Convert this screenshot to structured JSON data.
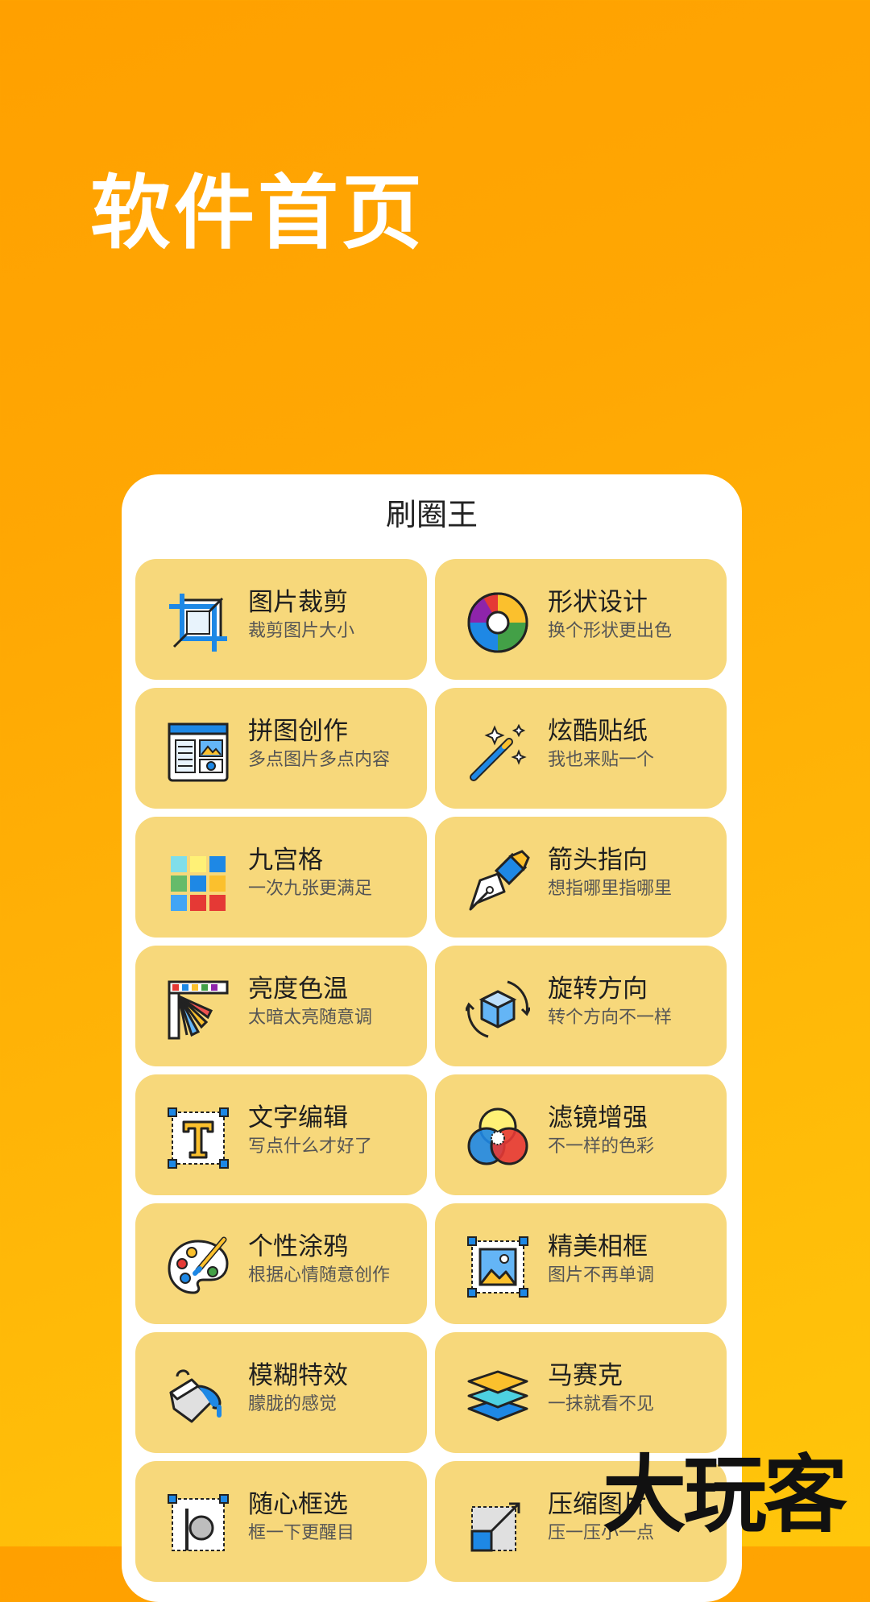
{
  "header": {
    "title": "软件首页"
  },
  "card": {
    "title": "刷圈王",
    "items": [
      {
        "name": "图片裁剪",
        "desc": "裁剪图片大小",
        "icon": "crop-icon"
      },
      {
        "name": "形状设计",
        "desc": "换个形状更出色",
        "icon": "color-wheel-icon"
      },
      {
        "name": "拼图创作",
        "desc": "多点图片多点内容",
        "icon": "collage-icon"
      },
      {
        "name": "炫酷贴纸",
        "desc": "我也来贴一个",
        "icon": "magic-wand-icon"
      },
      {
        "name": "九宫格",
        "desc": "一次九张更满足",
        "icon": "nine-grid-icon"
      },
      {
        "name": "箭头指向",
        "desc": "想指哪里指哪里",
        "icon": "pen-nib-icon"
      },
      {
        "name": "亮度色温",
        "desc": "太暗太亮随意调",
        "icon": "color-swatches-icon"
      },
      {
        "name": "旋转方向",
        "desc": "转个方向不一样",
        "icon": "rotate-cube-icon"
      },
      {
        "name": "文字编辑",
        "desc": "写点什么才好了",
        "icon": "text-box-icon"
      },
      {
        "name": "滤镜增强",
        "desc": "不一样的色彩",
        "icon": "filter-circles-icon"
      },
      {
        "name": "个性涂鸦",
        "desc": "根据心情随意创作",
        "icon": "paint-palette-icon"
      },
      {
        "name": "精美相框",
        "desc": "图片不再单调",
        "icon": "photo-frame-icon"
      },
      {
        "name": "模糊特效",
        "desc": "朦胧的感觉",
        "icon": "paint-bucket-icon"
      },
      {
        "name": "马赛克",
        "desc": "一抹就看不见",
        "icon": "layers-icon"
      },
      {
        "name": "随心框选",
        "desc": "框一下更醒目",
        "icon": "select-frame-icon"
      },
      {
        "name": "压缩图片",
        "desc": "压一压小一点",
        "icon": "compress-icon"
      }
    ]
  },
  "watermark": {
    "text": "大玩客"
  },
  "colors": {
    "tile": "#f7d87b",
    "background_top": "#ffa000",
    "background_bottom": "#ffc60b"
  }
}
